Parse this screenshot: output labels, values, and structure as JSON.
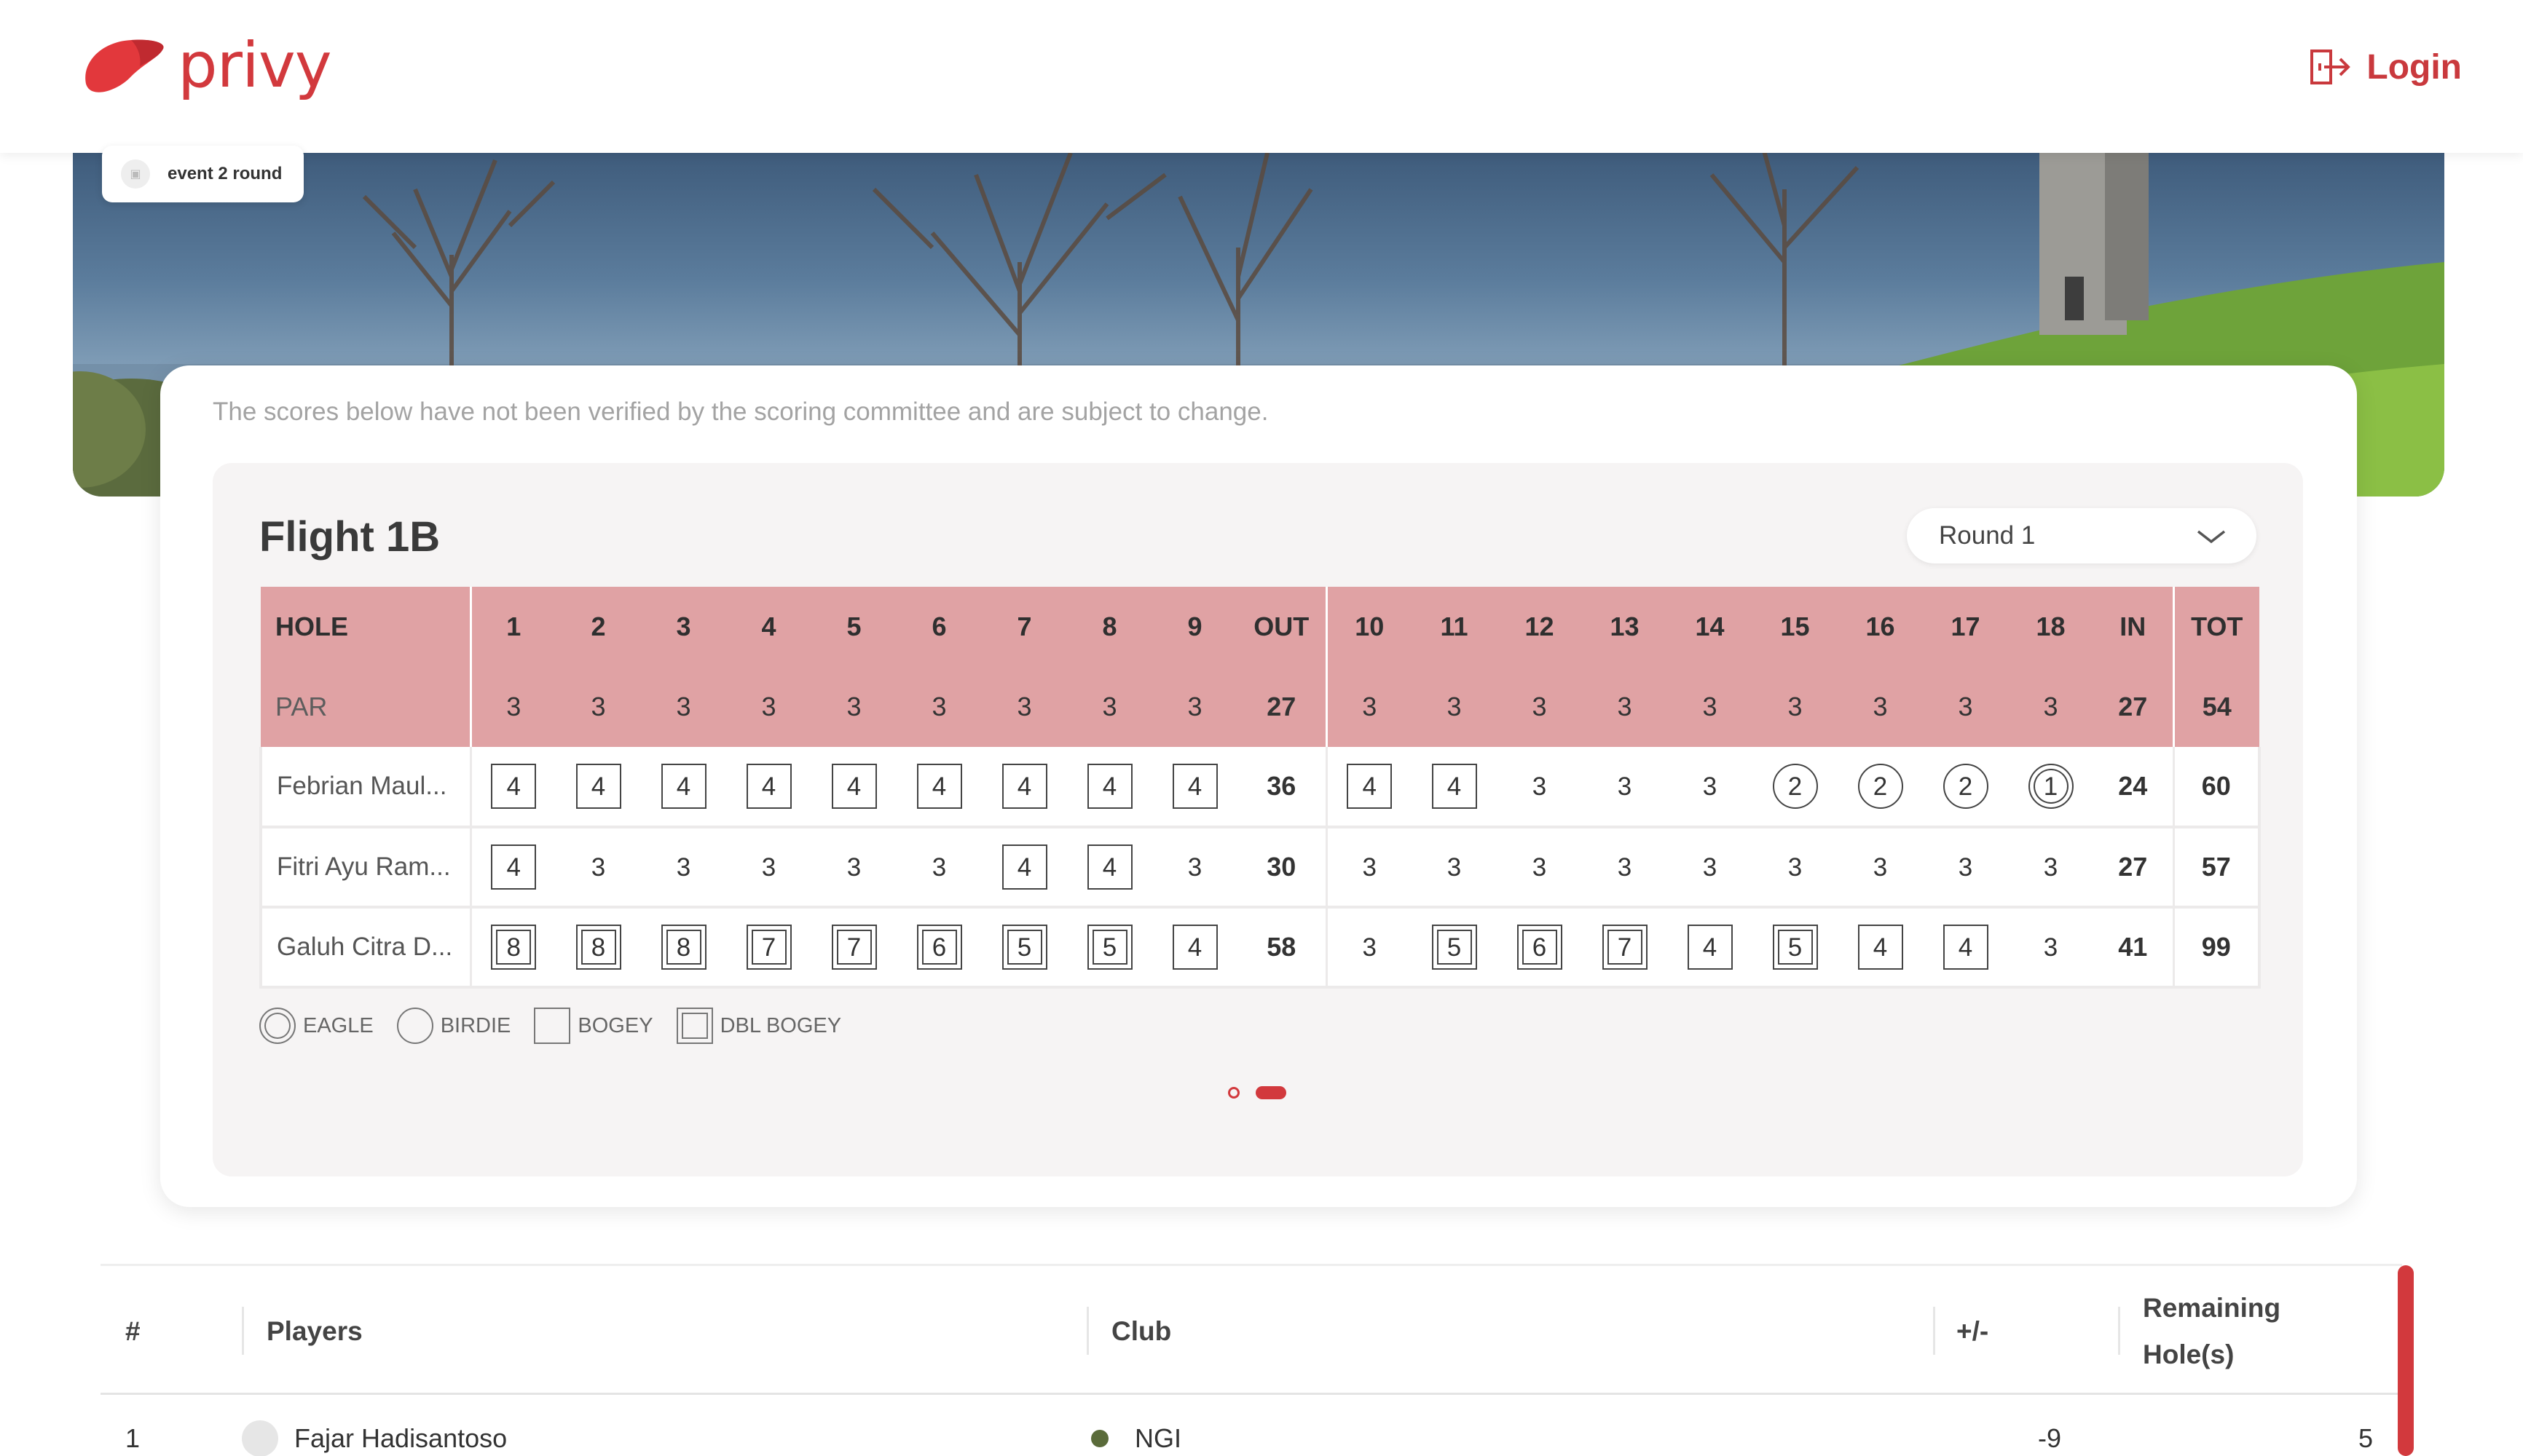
{
  "brand": {
    "name": "privy",
    "color": "#d2393d"
  },
  "header": {
    "login_label": "Login"
  },
  "banner": {
    "event_label": "event 2 round"
  },
  "notice": "The scores below have not been verified by the scoring committee and are subject to change.",
  "flight": {
    "title": "Flight 1B",
    "round_selected": "Round 1"
  },
  "scorecard": {
    "header": [
      "HOLE",
      "1",
      "2",
      "3",
      "4",
      "5",
      "6",
      "7",
      "8",
      "9",
      "OUT",
      "10",
      "11",
      "12",
      "13",
      "14",
      "15",
      "16",
      "17",
      "18",
      "IN",
      "TOT"
    ],
    "par": [
      "PAR",
      "3",
      "3",
      "3",
      "3",
      "3",
      "3",
      "3",
      "3",
      "3",
      "27",
      "3",
      "3",
      "3",
      "3",
      "3",
      "3",
      "3",
      "3",
      "3",
      "27",
      "54"
    ],
    "players": [
      {
        "name": "Febrian Maul...",
        "holes": [
          "4",
          "4",
          "4",
          "4",
          "4",
          "4",
          "4",
          "4",
          "4"
        ],
        "out": "36",
        "back": [
          "4",
          "4",
          "3",
          "3",
          "3",
          "2",
          "2",
          "2",
          "1"
        ],
        "in": "24",
        "tot": "60"
      },
      {
        "name": "Fitri Ayu Ram...",
        "holes": [
          "4",
          "3",
          "3",
          "3",
          "3",
          "3",
          "4",
          "4",
          "3"
        ],
        "out": "30",
        "back": [
          "3",
          "3",
          "3",
          "3",
          "3",
          "3",
          "3",
          "3",
          "3"
        ],
        "in": "27",
        "tot": "57"
      },
      {
        "name": "Galuh Citra D...",
        "holes": [
          "8",
          "8",
          "8",
          "7",
          "7",
          "6",
          "5",
          "5",
          "4"
        ],
        "out": "58",
        "back": [
          "3",
          "5",
          "6",
          "7",
          "4",
          "5",
          "4",
          "4",
          "3"
        ],
        "in": "41",
        "tot": "99"
      }
    ]
  },
  "legend": [
    "EAGLE",
    "BIRDIE",
    "BOGEY",
    "DBL BOGEY"
  ],
  "pagination": {
    "pages": 2,
    "current": 2
  },
  "leaderboard": {
    "columns": {
      "rank": "#",
      "players": "Players",
      "club": "Club",
      "plusminus": "+/-",
      "remaining_1": "Remaining",
      "remaining_2": "Hole(s)"
    },
    "first_row": {
      "rank": "1",
      "player": "Fajar Hadisantoso",
      "club": "NGI",
      "plusminus": "-9",
      "remaining": "5"
    }
  }
}
